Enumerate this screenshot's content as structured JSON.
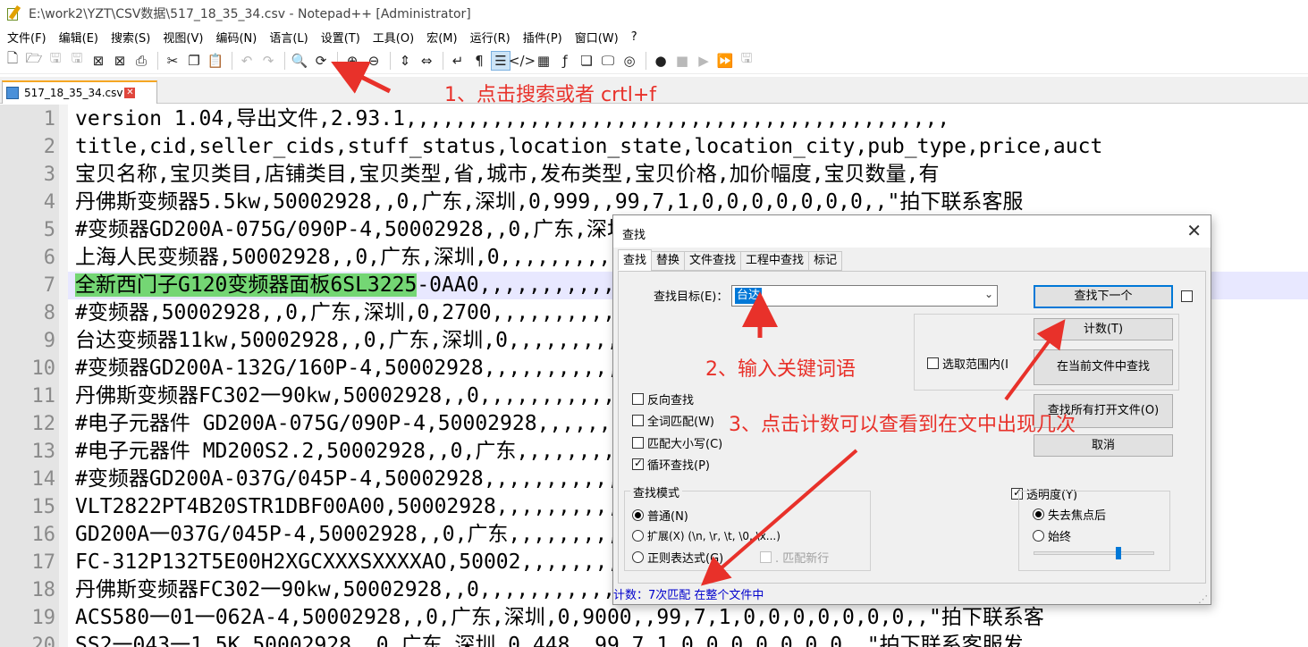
{
  "window": {
    "title": "E:\\work2\\YZT\\CSV数据\\517_18_35_34.csv - Notepad++ [Administrator]"
  },
  "menu": [
    "文件(F)",
    "编辑(E)",
    "搜索(S)",
    "视图(V)",
    "编码(N)",
    "语言(L)",
    "设置(T)",
    "工具(O)",
    "宏(M)",
    "运行(R)",
    "插件(P)",
    "窗口(W)",
    "?"
  ],
  "toolbar_icons": [
    "new-file",
    "open-file",
    "save",
    "save-all",
    "close",
    "close-all",
    "print",
    "cut",
    "copy",
    "paste",
    "undo",
    "redo",
    "find",
    "replace",
    "zoom-in",
    "zoom-out",
    "sync-vertical",
    "sync-horizontal",
    "word-wrap",
    "show-all-chars",
    "indent-guide",
    "user-language",
    "doc-map",
    "function-list",
    "folder-as-workspace",
    "monitor",
    "doc-snapshot",
    "record-macro",
    "stop-record",
    "play-macro",
    "run-macro-multiple",
    "save-macro"
  ],
  "tab": {
    "filename": "517_18_35_34.csv"
  },
  "editor": {
    "current_line": 7,
    "lines": [
      {
        "num": "1",
        "text": "version 1.04,导出文件,2.93.1,,,,,,,,,,,,,,,,,,,,,,,,,,,,,,,,,,,,,,,,,,,,"
      },
      {
        "num": "2",
        "text": "title,cid,seller_cids,stuff_status,location_state,location_city,pub_type,price,auct"
      },
      {
        "num": "3",
        "text": "宝贝名称,宝贝类目,店铺类目,宝贝类型,省,城市,发布类型,宝贝价格,加价幅度,宝贝数量,有"
      },
      {
        "num": "4",
        "text": "丹佛斯变频器5.5kw,50002928,,0,广东,深圳,0,999,,99,7,1,0,0,0,0,0,0,0,,\"拍下联系客服"
      },
      {
        "num": "5",
        "text": "#变频器GD200A-075G/090P-4,50002928,,0,广东,深圳,0,,,,,,,,,,,,,,,,,,,,,,,,0,,\"拍"
      },
      {
        "num": "6",
        "text": "上海人民变频器,50002928,,0,广东,深圳,0,,,,,,,,,,,,,,,,,,,,,,,,,,,,,客服发"
      },
      {
        "num": "7",
        "hl": "全新西门子G120变频器面板6SL3225",
        "text": "-0AA0,,,,,,,,,,,,,,,,,,,,,,,,,,,,,,1,0,0,"
      },
      {
        "num": "8",
        "text": "#变频器,50002928,,0,广东,深圳,0,2700,,,,,,,,,,,,,,,,,,,,,,,,,,,货！ <"
      },
      {
        "num": "9",
        "text": "台达变频器11kw,50002928,,0,广东,深圳,0,,,,,,,,,,,,,,,,,,,,,,,,,,客服发"
      },
      {
        "num": "10",
        "text": "#变频器GD200A-132G/160P-4,50002928,,,,,,,,,,,,,,,,,,,,,,,,,,,0,,\"拍"
      },
      {
        "num": "11",
        "text": "丹佛斯变频器FC302一90kw,50002928,,0,,,,,,,,,,,,,,,,,,,,,,,,,\"拍下"
      },
      {
        "num": "12",
        "text": "#电子元器件 GD200A-075G/090P-4,50002928,,,,,,,,,,,,,,,,,,,,,,,0,0,0,"
      },
      {
        "num": "13",
        "text": "#电子元器件 MD200S2.2,50002928,,0,广东,,,,,,,,,,,,,,,,,,,,,,拍下联系"
      },
      {
        "num": "14",
        "text": "#变频器GD200A-037G/045P-4,50002928,,,,,,,,,,,,,,,,,,,,,,,,,,0,,\"拍"
      },
      {
        "num": "15",
        "text": "VLT2822PT4B20STR1DBF00A00,50002928,,,,,,,,,,,,,,,,,,,,,,,,,0,,\"拍"
      },
      {
        "num": "16",
        "text": "GD200A一037G/045P-4,50002928,,0,广东,,,,,,,,,,,,,,,,,,,,,,,下联系客"
      },
      {
        "num": "17",
        "text": "FC-312P132T5E00H2XGCXXXSXXXXAO,50002,,,,,,,,,,,,,,,,,,,,,,,,0,0,0"
      },
      {
        "num": "18",
        "text": "丹佛斯变频器FC302一90kw,50002928,,0,,,,,,,,,,,,,,,,,,,,,,,,,,\"拍下"
      },
      {
        "num": "19",
        "text": "ACS580一01一062A-4,50002928,,0,广东,深圳,0,9000,,99,7,1,0,0,0,0,0,0,0,,\"拍下联系客"
      },
      {
        "num": "20",
        "text": "SS2一043一1.5K,50002928,,0,广东,深圳,0,448,,99,7,1,0,0,0,0,0,0,0,,\"拍下联系客服发"
      }
    ]
  },
  "find_dialog": {
    "title": "查找",
    "close_glyph": "✕",
    "tabs": [
      "查找",
      "替换",
      "文件查找",
      "工程中查找",
      "标记"
    ],
    "search_label": "查找目标(E)：",
    "search_value": "台达",
    "buttons": {
      "find_next": "查找下一个",
      "count": "计数(T)",
      "find_in_current": "在当前文件中查找",
      "find_all_open": "查找所有打开文件(O)",
      "cancel": "取消"
    },
    "in_selection": "选取范围内(I",
    "options": [
      {
        "label": "反向查找",
        "checked": false
      },
      {
        "label": "全词匹配(W)",
        "checked": false
      },
      {
        "label": "匹配大小写(C)",
        "checked": false
      },
      {
        "label": "循环查找(P)",
        "checked": true
      }
    ],
    "search_mode": {
      "title": "查找模式",
      "modes": [
        {
          "label": "普通(N)",
          "selected": true
        },
        {
          "label": "扩展(X) (\\n, \\r, \\t, \\0, \\x...)",
          "selected": false
        },
        {
          "label": "正则表达式(G)",
          "selected": false
        }
      ],
      "dot_newline": ". 匹配新行"
    },
    "transparency": {
      "label": "透明度(Y)",
      "checked": true,
      "options": [
        {
          "label": "失去焦点后",
          "selected": true
        },
        {
          "label": "始终",
          "selected": false
        }
      ],
      "level": 0.7
    },
    "status": "计数：7次匹配 在整个文件中"
  },
  "annotations": {
    "step1": "1、点击搜索或者 crtl+f",
    "step2": "2、输入关键词语",
    "step3": "3、点击计数可以查看到在文中出现几次",
    "color": "#e8312a"
  }
}
